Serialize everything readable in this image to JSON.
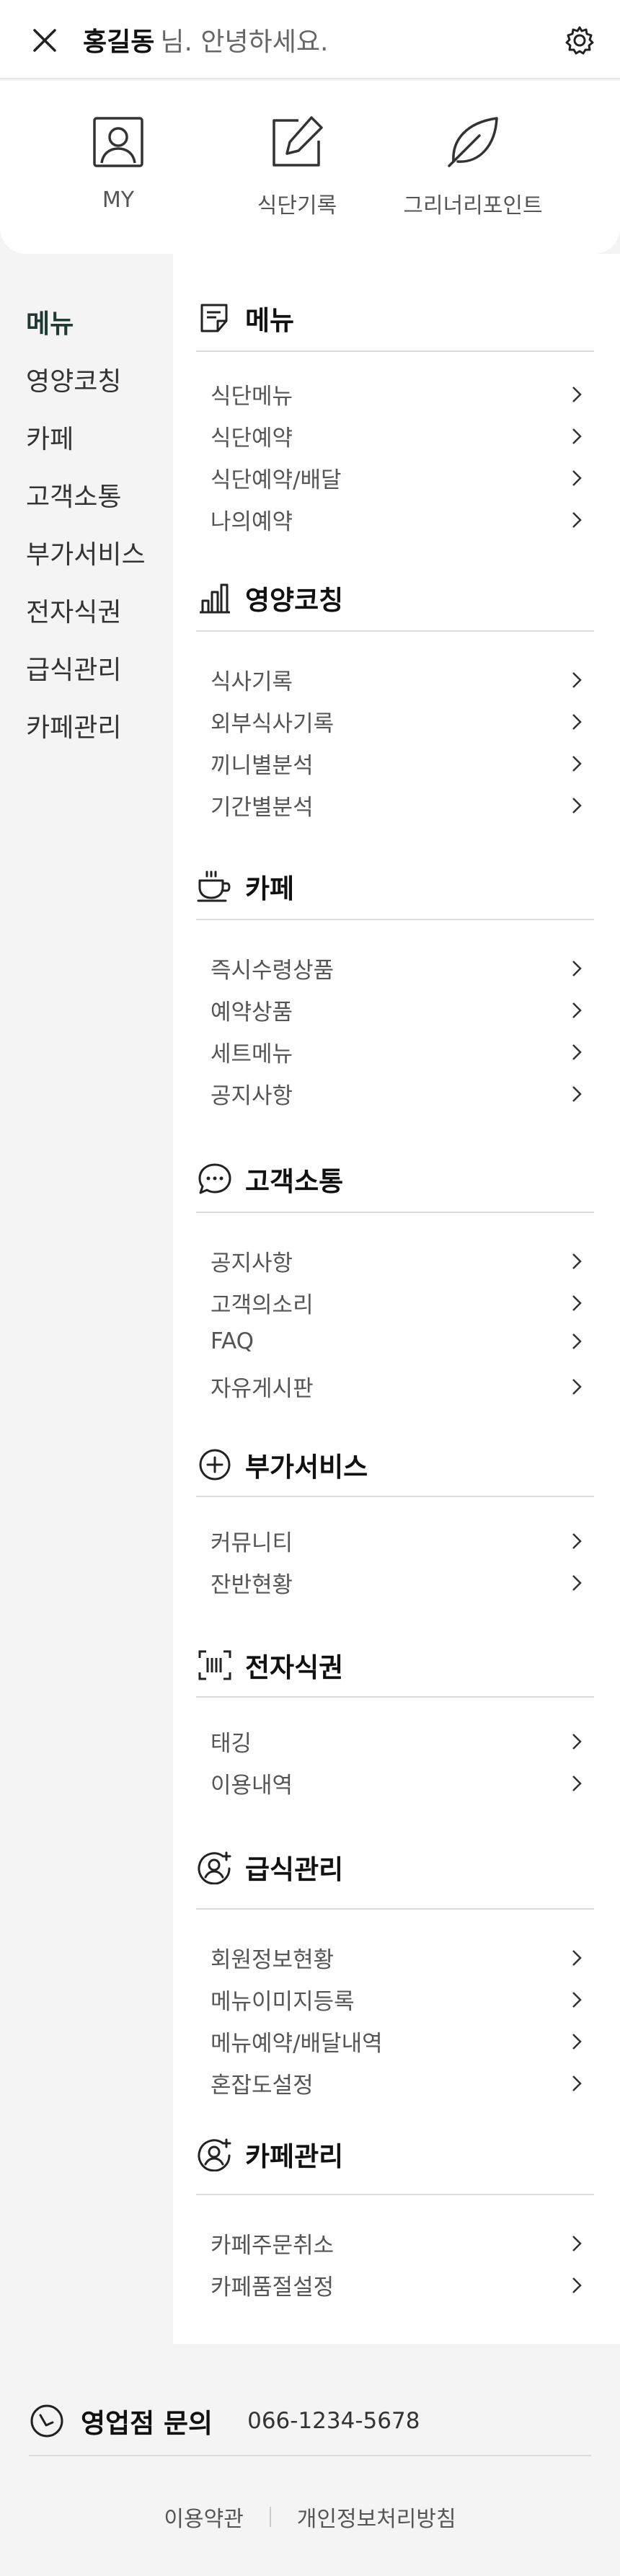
{
  "header": {
    "user_name": "홍길동",
    "greeting_suffix": "님. 안녕하세요."
  },
  "quick_menu": [
    {
      "label": "MY",
      "icon": "user-icon"
    },
    {
      "label": "식단기록",
      "icon": "edit-icon"
    },
    {
      "label": "그리너리포인트",
      "icon": "leaf-icon"
    }
  ],
  "left_nav": [
    {
      "label": "메뉴",
      "active": true
    },
    {
      "label": "영양코칭"
    },
    {
      "label": "카페"
    },
    {
      "label": "고객소통"
    },
    {
      "label": "부가서비스"
    },
    {
      "label": "전자식권"
    },
    {
      "label": "급식관리"
    },
    {
      "label": "카페관리"
    }
  ],
  "sections": [
    {
      "title": "메뉴",
      "icon": "document-icon",
      "items": [
        "식단메뉴",
        "식단예약",
        "식단예약/배달",
        "나의예약"
      ]
    },
    {
      "title": "영양코칭",
      "icon": "bar-chart-icon",
      "items": [
        "식사기록",
        "외부식사기록",
        "끼니별분석",
        "기간별분석"
      ]
    },
    {
      "title": "카페",
      "icon": "coffee-cup-icon",
      "items": [
        "즉시수령상품",
        "예약상품",
        "세트메뉴",
        "공지사항"
      ]
    },
    {
      "title": "고객소통",
      "icon": "chat-bubble-icon",
      "items": [
        "공지사항",
        "고객의소리",
        "FAQ",
        "자유게시판"
      ]
    },
    {
      "title": "부가서비스",
      "icon": "plus-circle-icon",
      "items": [
        "커뮤니티",
        "잔반현황"
      ]
    },
    {
      "title": "전자식권",
      "icon": "barcode-scan-icon",
      "items": [
        "태깅",
        "이용내역"
      ]
    },
    {
      "title": "급식관리",
      "icon": "user-add-icon",
      "items": [
        "회원정보현황",
        "메뉴이미지등록",
        "메뉴예약/배달내역",
        "혼잡도설정"
      ]
    },
    {
      "title": "카페관리",
      "icon": "user-add-icon",
      "items": [
        "카페주문취소",
        "카페품절설정"
      ]
    }
  ],
  "footer": {
    "inquiry_title": "영업점 문의",
    "phone": "066-1234-5678",
    "terms": "이용약관",
    "privacy": "개인정보처리방침"
  }
}
